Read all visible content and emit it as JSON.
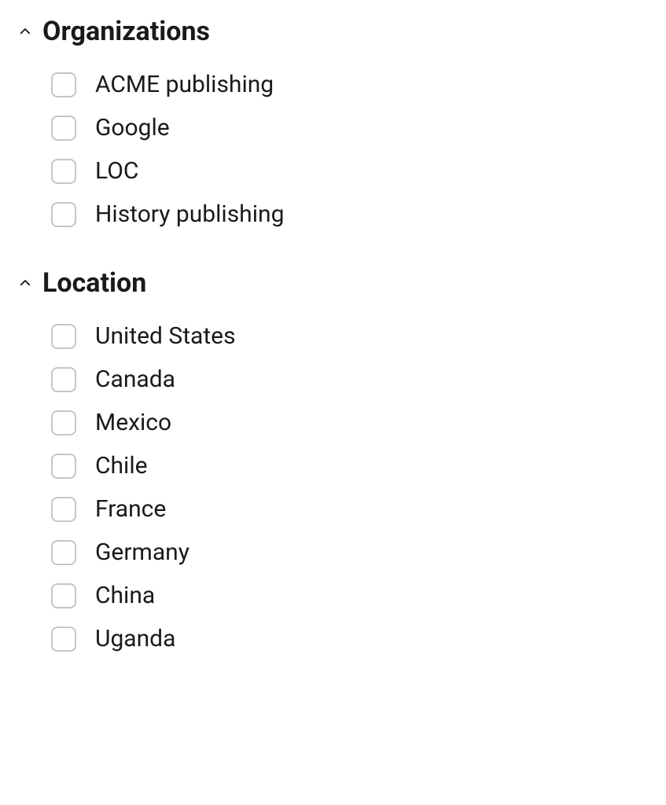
{
  "filters": {
    "organizations": {
      "title": "Organizations",
      "options": [
        {
          "label": "ACME publishing"
        },
        {
          "label": "Google"
        },
        {
          "label": "LOC"
        },
        {
          "label": "History publishing"
        }
      ]
    },
    "location": {
      "title": "Location",
      "options": [
        {
          "label": "United States"
        },
        {
          "label": "Canada"
        },
        {
          "label": "Mexico"
        },
        {
          "label": "Chile"
        },
        {
          "label": "France"
        },
        {
          "label": "Germany"
        },
        {
          "label": "China"
        },
        {
          "label": "Uganda"
        }
      ]
    }
  }
}
